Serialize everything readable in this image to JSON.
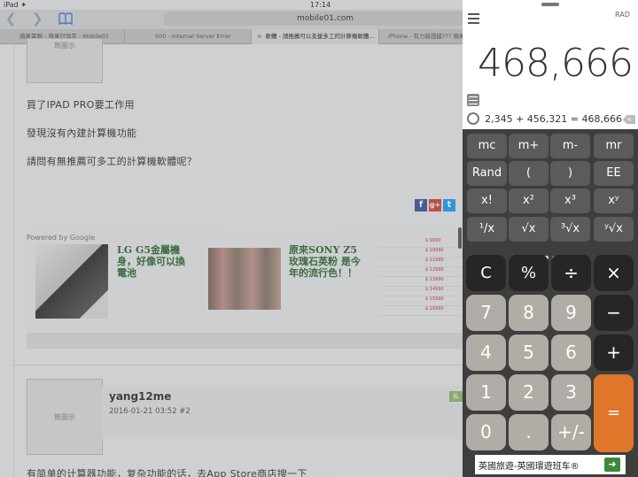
{
  "statusbar": {
    "device": "iPad",
    "wifi": "✦",
    "time": "17:14"
  },
  "safari": {
    "url": "mobile01.com",
    "tabs": [
      {
        "label": "蘋果電腦 - 蘋果討論區 - Mobile01"
      },
      {
        "label": "500 - Internal Server Error"
      },
      {
        "label": "軟體 - 請推薦可以支援多工的計算機軟體...",
        "close": "⊗"
      },
      {
        "label": "iPhone - 有力新證據??? 蘋果..."
      }
    ],
    "noimage_label": "無圖示",
    "post_lines": [
      "買了IPAD PRO要工作用",
      "發現沒有內建計算機功能",
      "請問有無推薦可多工的計算機軟體呢？"
    ],
    "share": {
      "facebook": "f",
      "googleplus": "g+",
      "twitter": "t"
    },
    "ads": {
      "powered_by": "Powered by Google",
      "ad1_title": "LG G5金屬機身，好像可以換電池",
      "ad2_title": "原來SONY Z5 玫瑰石英粉 是今年的流行色！！",
      "price_rows": [
        {
          "label": "",
          "value": "$ 9990"
        },
        {
          "label": "",
          "value": "$ 10990"
        },
        {
          "label": "",
          "value": "$ 11990"
        },
        {
          "label": "",
          "value": "$ 12990"
        },
        {
          "label": "",
          "value": "$ 13990"
        },
        {
          "label": "",
          "value": "$ 14990"
        },
        {
          "label": "",
          "value": "$ 15990"
        },
        {
          "label": "",
          "value": "$ 16990"
        }
      ]
    },
    "reply": {
      "username": "yang12me",
      "meta": "2016-01-21 03:52   #2",
      "badge": "私",
      "text": "有简单的计算器功能，复杂功能的话，去App Store商店搜一下"
    }
  },
  "calculator": {
    "mode": "RAD",
    "display_value": "468,666",
    "history": "2,345 + 456,321 = 468,666",
    "history_delete": "×",
    "scientific_rows": [
      [
        {
          "label": "mc"
        },
        {
          "label": "m+"
        },
        {
          "label": "m-"
        },
        {
          "label": "mr"
        }
      ],
      [
        {
          "label": "Rand"
        },
        {
          "label": "("
        },
        {
          "label": ")"
        },
        {
          "label": "EE"
        }
      ],
      [
        {
          "label": "x!"
        },
        {
          "label": "x²"
        },
        {
          "label": "x³"
        },
        {
          "label": "xʸ"
        }
      ],
      [
        {
          "label": "¹/x"
        },
        {
          "label": "√x"
        },
        {
          "label": "³√x"
        },
        {
          "label": "ʸ√x"
        }
      ]
    ],
    "keys": {
      "clear": "C",
      "percent": "%",
      "divide": "÷",
      "multiply": "×",
      "seven": "7",
      "eight": "8",
      "nine": "9",
      "minus": "−",
      "four": "4",
      "five": "5",
      "six": "6",
      "plus": "+",
      "one": "1",
      "two": "2",
      "three": "3",
      "equals": "=",
      "zero": "0",
      "decimal": ".",
      "sign": "+/-"
    },
    "ad_text": "英國旅遊-英國環遊班车®",
    "ad_go": "➜",
    "colors": {
      "equals": "#e0762a",
      "digits": "#b0aca6",
      "functions": "#262626",
      "scientific": "#5b5b5b"
    }
  }
}
